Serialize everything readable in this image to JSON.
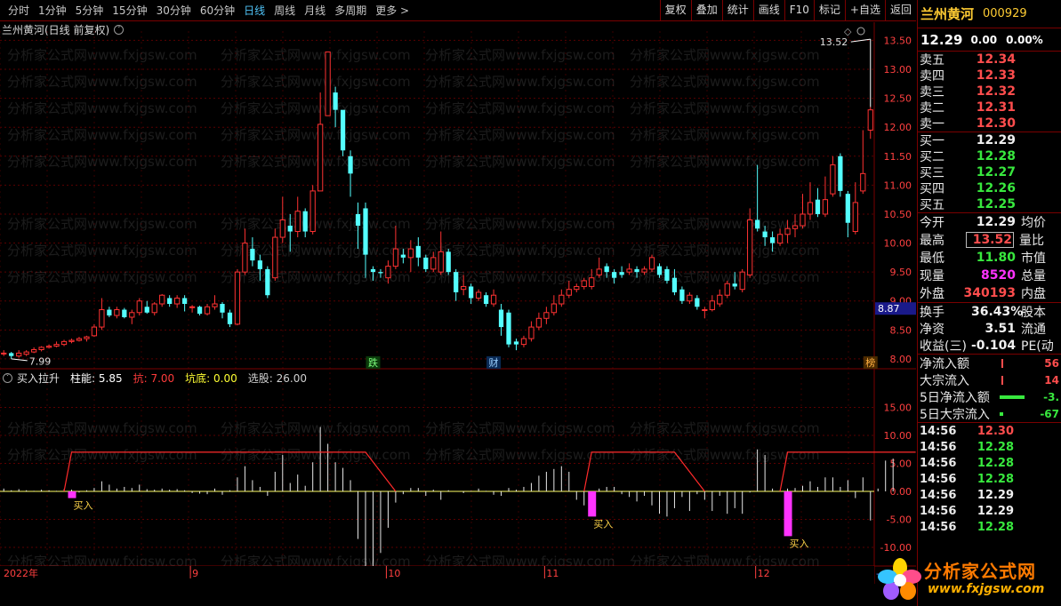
{
  "toolbar": {
    "tabs": [
      "分时",
      "1分钟",
      "5分钟",
      "15分钟",
      "30分钟",
      "60分钟",
      "日线",
      "周线",
      "月线",
      "多周期",
      "更多 >"
    ],
    "active_tab": "日线",
    "right_buttons": [
      "复权",
      "叠加",
      "统计",
      "画线",
      "F10",
      "标记",
      "+自选",
      "返回"
    ]
  },
  "chart_header": {
    "title": "兰州黄河(日线 前复权)",
    "toggle": "˅"
  },
  "indicator_header": {
    "name": "买入拉升",
    "items": [
      {
        "label": "柱能: 5.85",
        "color": "#ffffff"
      },
      {
        "label": "抗: 7.00",
        "color": "#ff3b3b"
      },
      {
        "label": "坑底: 0.00",
        "color": "#ffff33"
      },
      {
        "label": "选股: 26.00",
        "color": "#d0d0d0"
      }
    ]
  },
  "watermark": "分析家公式网www.fxjgsw.com",
  "x_axis": {
    "labels": [
      {
        "text": "2022年",
        "bar": 0
      },
      {
        "text": "9",
        "bar": 25
      },
      {
        "text": "10",
        "bar": 51
      },
      {
        "text": "11",
        "bar": 72
      },
      {
        "text": "12",
        "bar": 100
      }
    ],
    "end_marker": "--"
  },
  "price_axis_ticks": [
    "13.50",
    "13.00",
    "12.50",
    "12.00",
    "11.50",
    "11.00",
    "10.50",
    "10.00",
    "9.50",
    "9.00",
    "8.50",
    "8.00"
  ],
  "indicator_axis_ticks": [
    "15.00",
    "10.00",
    "5.00",
    "0.00",
    "-5.00",
    "-10.00",
    "-15.00"
  ],
  "current_price_label": "8.87",
  "annotations": {
    "high_label": "13.52",
    "low_label": "7.99",
    "tag_die": "跌",
    "tag_cai": "财",
    "tag_bang": "榜",
    "buy": "买入"
  },
  "colors": {
    "up": "#ff3232",
    "down": "#54ffff",
    "grid": "#7a0000",
    "buy_bar": "#ff33ff"
  },
  "chart_data": {
    "type": "candlestick",
    "title": "兰州黄河(日线 前复权)",
    "ylim": [
      7.9,
      13.6
    ],
    "candles": [
      [
        8.1,
        8.1,
        8.15,
        8.05
      ],
      [
        8.1,
        8.05,
        8.12,
        8.0
      ],
      [
        8.05,
        8.1,
        8.15,
        8.02
      ],
      [
        8.08,
        8.12,
        8.15,
        8.05
      ],
      [
        8.12,
        8.16,
        8.2,
        8.1
      ],
      [
        8.16,
        8.2,
        8.22,
        8.13
      ],
      [
        8.2,
        8.22,
        8.25,
        8.18
      ],
      [
        8.22,
        8.25,
        8.3,
        8.2
      ],
      [
        8.25,
        8.3,
        8.33,
        8.22
      ],
      [
        8.3,
        8.32,
        8.35,
        8.27
      ],
      [
        8.32,
        8.35,
        8.38,
        8.3
      ],
      [
        8.35,
        8.38,
        8.4,
        8.3
      ],
      [
        8.4,
        8.55,
        8.6,
        8.38
      ],
      [
        8.55,
        8.85,
        9.05,
        8.5
      ],
      [
        8.85,
        8.75,
        8.9,
        8.72
      ],
      [
        8.75,
        8.85,
        8.9,
        8.7
      ],
      [
        8.85,
        8.72,
        8.88,
        8.7
      ],
      [
        8.72,
        8.8,
        8.85,
        8.6
      ],
      [
        8.8,
        9.0,
        9.05,
        8.75
      ],
      [
        8.9,
        8.8,
        9.0,
        8.78
      ],
      [
        8.8,
        8.95,
        8.98,
        8.75
      ],
      [
        8.95,
        9.1,
        9.12,
        8.9
      ],
      [
        9.05,
        8.95,
        9.1,
        8.9
      ],
      [
        8.95,
        9.05,
        9.1,
        8.88
      ],
      [
        9.05,
        8.95,
        9.1,
        8.82
      ],
      [
        8.9,
        8.9,
        8.93,
        8.8
      ],
      [
        8.9,
        8.78,
        8.92,
        8.75
      ],
      [
        8.78,
        8.9,
        8.95,
        8.75
      ],
      [
        8.9,
        8.95,
        9.1,
        8.85
      ],
      [
        8.95,
        8.8,
        8.98,
        8.7
      ],
      [
        8.8,
        8.6,
        8.85,
        8.55
      ],
      [
        8.6,
        9.5,
        9.55,
        8.58
      ],
      [
        9.5,
        10.0,
        10.25,
        9.45
      ],
      [
        9.9,
        9.7,
        10.1,
        9.6
      ],
      [
        9.7,
        9.55,
        9.8,
        9.35
      ],
      [
        9.55,
        9.1,
        9.6,
        9.05
      ],
      [
        9.4,
        10.1,
        10.25,
        9.35
      ],
      [
        10.1,
        10.4,
        10.8,
        10.0
      ],
      [
        10.3,
        10.2,
        10.5,
        9.85
      ],
      [
        10.2,
        10.55,
        10.8,
        10.1
      ],
      [
        10.55,
        10.2,
        10.6,
        10.1
      ],
      [
        10.2,
        10.9,
        11.0,
        10.15
      ],
      [
        10.9,
        12.05,
        12.6,
        10.9
      ],
      [
        12.2,
        13.3,
        13.3,
        12.2
      ],
      [
        12.6,
        12.3,
        12.7,
        12.0
      ],
      [
        12.3,
        11.6,
        12.2,
        11.5
      ],
      [
        11.5,
        11.2,
        11.6,
        10.8
      ],
      [
        10.5,
        10.3,
        10.7,
        9.9
      ],
      [
        10.6,
        9.8,
        10.7,
        9.4
      ],
      [
        9.55,
        9.5,
        9.6,
        9.35
      ],
      [
        9.5,
        9.48,
        9.55,
        9.4
      ],
      [
        9.4,
        9.6,
        9.7,
        9.3
      ],
      [
        9.6,
        9.9,
        10.3,
        9.55
      ],
      [
        9.8,
        9.75,
        9.9,
        9.65
      ],
      [
        9.75,
        9.9,
        10.05,
        9.5
      ],
      [
        9.95,
        9.75,
        10.1,
        9.6
      ],
      [
        9.75,
        9.55,
        9.8,
        9.5
      ],
      [
        9.55,
        9.75,
        9.85,
        9.5
      ],
      [
        9.5,
        9.85,
        10.2,
        9.45
      ],
      [
        9.85,
        9.5,
        9.9,
        9.45
      ],
      [
        9.5,
        9.15,
        9.55,
        9.0
      ],
      [
        9.2,
        9.25,
        9.45,
        9.1
      ],
      [
        9.25,
        9.05,
        9.3,
        8.95
      ],
      [
        9.05,
        9.15,
        9.2,
        9.0
      ],
      [
        9.1,
        8.95,
        9.15,
        8.9
      ],
      [
        8.95,
        9.1,
        9.2,
        8.9
      ],
      [
        8.85,
        8.55,
        8.95,
        8.4
      ],
      [
        8.8,
        8.25,
        8.85,
        8.2
      ],
      [
        8.3,
        8.25,
        8.35,
        8.15
      ],
      [
        8.25,
        8.35,
        8.4,
        8.2
      ],
      [
        8.35,
        8.55,
        8.65,
        8.3
      ],
      [
        8.55,
        8.7,
        8.8,
        8.5
      ],
      [
        8.7,
        8.8,
        8.9,
        8.6
      ],
      [
        8.8,
        8.95,
        9.1,
        8.75
      ],
      [
        8.95,
        9.1,
        9.2,
        8.9
      ],
      [
        9.1,
        9.2,
        9.35,
        9.05
      ],
      [
        9.2,
        9.25,
        9.3,
        9.15
      ],
      [
        9.25,
        9.35,
        9.4,
        9.2
      ],
      [
        9.25,
        9.4,
        9.55,
        9.2
      ],
      [
        9.45,
        9.55,
        9.75,
        9.4
      ],
      [
        9.6,
        9.5,
        9.65,
        9.4
      ],
      [
        9.5,
        9.4,
        9.55,
        9.3
      ],
      [
        9.5,
        9.45,
        9.6,
        9.4
      ],
      [
        9.5,
        9.55,
        9.65,
        9.45
      ],
      [
        9.55,
        9.5,
        9.6,
        9.4
      ],
      [
        9.5,
        9.55,
        9.6,
        9.45
      ],
      [
        9.55,
        9.75,
        9.8,
        9.5
      ],
      [
        9.6,
        9.45,
        9.65,
        9.4
      ],
      [
        9.55,
        9.35,
        9.6,
        9.3
      ],
      [
        9.4,
        9.15,
        9.55,
        9.1
      ],
      [
        9.2,
        9.0,
        9.25,
        8.95
      ],
      [
        9.0,
        9.1,
        9.15,
        8.95
      ],
      [
        9.05,
        8.9,
        9.1,
        8.85
      ],
      [
        8.85,
        8.85,
        8.9,
        8.7
      ],
      [
        8.85,
        9.0,
        9.1,
        8.82
      ],
      [
        8.95,
        9.1,
        9.2,
        8.9
      ],
      [
        9.1,
        9.3,
        9.35,
        9.05
      ],
      [
        9.3,
        9.25,
        9.5,
        9.2
      ],
      [
        9.2,
        9.5,
        9.55,
        9.15
      ],
      [
        9.45,
        10.4,
        10.6,
        9.4
      ],
      [
        10.4,
        10.25,
        11.35,
        10.2
      ],
      [
        10.2,
        10.1,
        10.3,
        9.95
      ],
      [
        10.1,
        10.0,
        10.2,
        9.85
      ],
      [
        10.0,
        10.15,
        10.25,
        9.95
      ],
      [
        10.15,
        10.25,
        10.4,
        10.0
      ],
      [
        10.25,
        10.3,
        10.5,
        10.1
      ],
      [
        10.3,
        10.5,
        10.85,
        10.25
      ],
      [
        10.5,
        10.7,
        11.05,
        10.4
      ],
      [
        10.75,
        10.5,
        10.95,
        10.45
      ],
      [
        10.5,
        10.75,
        11.15,
        10.45
      ],
      [
        10.85,
        11.35,
        11.5,
        10.8
      ],
      [
        11.5,
        10.9,
        11.55,
        10.8
      ],
      [
        10.85,
        10.35,
        10.9,
        10.1
      ],
      [
        10.2,
        10.7,
        11.05,
        10.15
      ],
      [
        10.9,
        11.2,
        11.95,
        10.85
      ],
      [
        11.95,
        12.3,
        12.35,
        11.8
      ]
    ],
    "indicator": {
      "name": "买入拉升",
      "histogram": [
        0.5,
        0.2,
        0.4,
        0.2,
        0.1,
        0.3,
        0.2,
        0.1,
        0.4,
        0.3,
        -0.2,
        0.2,
        0.6,
        1.8,
        1.2,
        0.5,
        0.8,
        0.6,
        1.2,
        0.4,
        0.3,
        0.5,
        0.3,
        0.4,
        0.2,
        -0.3,
        -0.4,
        -0.5,
        0.5,
        -0.6,
        0.2,
        2.5,
        4.5,
        2.0,
        0.8,
        -0.8,
        3.5,
        6.5,
        1.5,
        3.0,
        1.0,
        5.2,
        11.5,
        8.5,
        5.2,
        4.2,
        2.0,
        -8.5,
        -15.5,
        -15.5,
        -11.0,
        -6.5,
        -2.0,
        -0.5,
        0.6,
        0.6,
        -0.8,
        0.3,
        -1.5,
        0.2,
        0.0,
        -0.3,
        0.1,
        0.5,
        0.1,
        -0.6,
        -0.8,
        0.6,
        0.3,
        0.8,
        1.5,
        2.8,
        3.5,
        4.0,
        4.5,
        3.5,
        -1.5,
        -2.5,
        -0.5,
        0.5,
        0.8,
        0.8,
        -0.5,
        -1.0,
        -1.8,
        -0.8,
        -2.5,
        -4.0,
        -4.5,
        -3.0,
        -1.0,
        -3.5,
        -0.5,
        -1.5,
        -3.5,
        -0.8,
        -4.0,
        -3.0,
        -4.0,
        -0.2,
        7.5,
        6.5,
        0.5,
        0.2,
        0.5,
        0.6,
        1.0,
        1.8,
        0.8,
        2.5,
        2.5,
        0.8,
        2.0,
        -1.2,
        2.5,
        -5.2,
        0.5,
        5.5,
        5.85
      ],
      "buy_signals": [
        {
          "bar": 9,
          "value": -1.2
        },
        {
          "bar": 78,
          "value": -4.5
        },
        {
          "bar": 104,
          "value": -8.0
        }
      ],
      "resist_segments": [
        [
          [
            8,
            0
          ],
          [
            9,
            7
          ],
          [
            48,
            7
          ],
          [
            52,
            0
          ]
        ],
        [
          [
            77,
            0
          ],
          [
            78,
            7
          ],
          [
            89,
            7
          ],
          [
            93,
            0
          ]
        ],
        [
          [
            103,
            0
          ],
          [
            104,
            7
          ],
          [
            121,
            7
          ]
        ]
      ],
      "ylim": [
        -16,
        16
      ]
    }
  },
  "quote": {
    "name": "兰州黄河",
    "code": "000929",
    "price": "12.29",
    "change": "0.00",
    "change_pct": "0.00%",
    "asks": [
      {
        "label": "卖五",
        "price": "12.34"
      },
      {
        "label": "卖四",
        "price": "12.33"
      },
      {
        "label": "卖三",
        "price": "12.32"
      },
      {
        "label": "卖二",
        "price": "12.31"
      },
      {
        "label": "卖一",
        "price": "12.30"
      }
    ],
    "bids": [
      {
        "label": "买一",
        "price": "12.29"
      },
      {
        "label": "买二",
        "price": "12.28"
      },
      {
        "label": "买三",
        "price": "12.27"
      },
      {
        "label": "买四",
        "price": "12.26"
      },
      {
        "label": "买五",
        "price": "12.25"
      }
    ],
    "stats": [
      {
        "label": "今开",
        "value": "12.29",
        "color": "wht",
        "label2": "均价"
      },
      {
        "label": "最高",
        "value": "13.52",
        "color": "red",
        "label2": "量比"
      },
      {
        "label": "最低",
        "value": "11.80",
        "color": "grn",
        "label2": "市值"
      },
      {
        "label": "现量",
        "value": "8520",
        "color": "mag",
        "label2": "总量"
      },
      {
        "label": "外盘",
        "value": "340193",
        "color": "red",
        "label2": "内盘"
      }
    ],
    "stats2": [
      {
        "label": "换手",
        "value": "36.43%",
        "label2": "股本"
      },
      {
        "label": "净资",
        "value": "3.51",
        "label2": "流通"
      },
      {
        "label": "收益(三)",
        "value": "-0.104",
        "label2": "PE(动"
      }
    ],
    "flows": [
      {
        "label": "净流入额",
        "value": "56",
        "color": "red",
        "bar": 0
      },
      {
        "label": "大宗流入",
        "value": "14",
        "color": "red",
        "bar": 0
      },
      {
        "label": "5日净流入额",
        "value": "-3.",
        "color": "grn",
        "bar": 28
      },
      {
        "label": "5日大宗流入",
        "value": "-67",
        "color": "grn",
        "bar": 4
      }
    ],
    "ticks": [
      {
        "time": "14:56",
        "price": "12.30",
        "color": "red"
      },
      {
        "time": "14:56",
        "price": "12.28",
        "color": "grn"
      },
      {
        "time": "14:56",
        "price": "12.28",
        "color": "grn"
      },
      {
        "time": "14:56",
        "price": "12.28",
        "color": "grn"
      },
      {
        "time": "14:56",
        "price": "12.29",
        "color": "wht"
      },
      {
        "time": "14:56",
        "price": "12.29",
        "color": "wht"
      },
      {
        "time": "14:56",
        "price": "12.28",
        "color": "grn"
      }
    ]
  },
  "logo": {
    "text": "分析家公式网",
    "url": "www.fxjgsw.com"
  }
}
